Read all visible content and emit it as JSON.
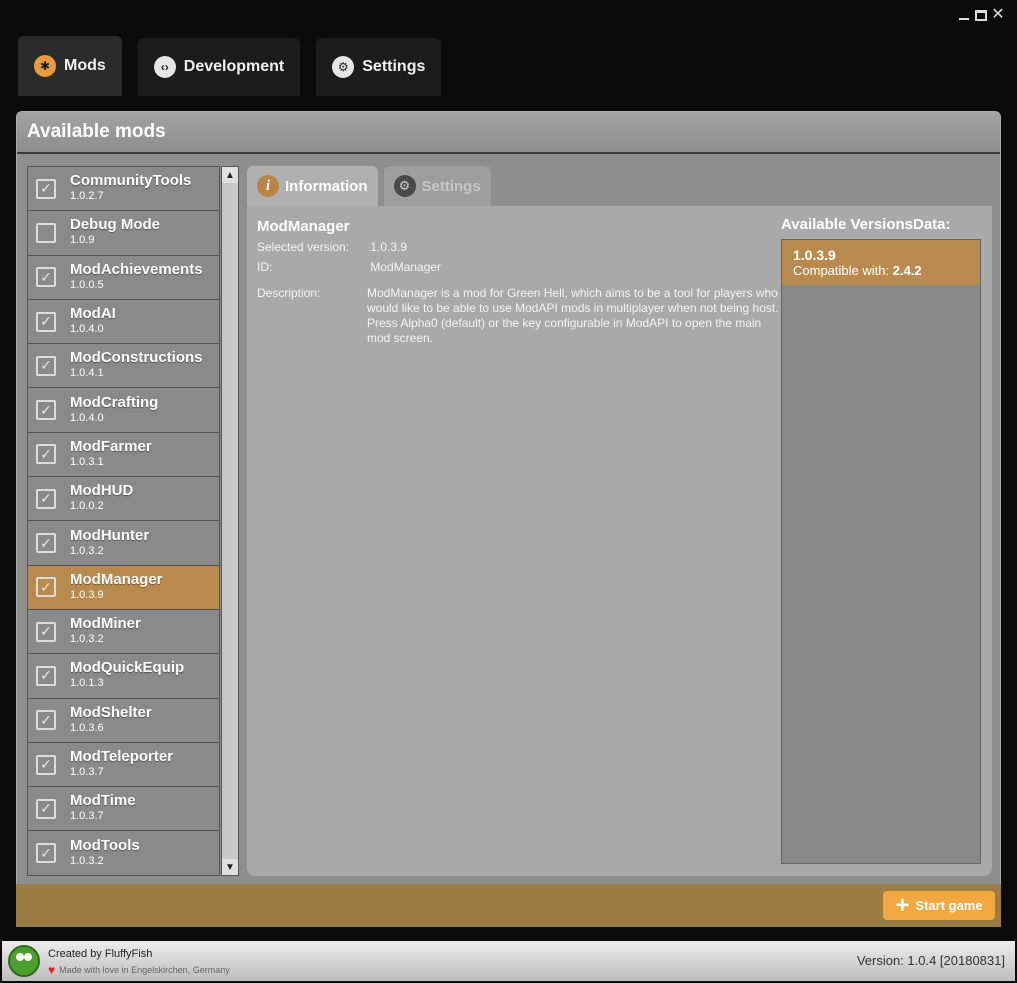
{
  "main_tabs": [
    {
      "label": "Mods"
    },
    {
      "label": "Development"
    },
    {
      "label": "Settings"
    }
  ],
  "panel": {
    "title": "Available mods"
  },
  "mods": [
    {
      "name": "CommunityTools",
      "version": "1.0.2.7",
      "checked": true
    },
    {
      "name": "Debug Mode",
      "version": "1.0.9",
      "checked": false
    },
    {
      "name": "ModAchievements",
      "version": "1.0.0.5",
      "checked": true
    },
    {
      "name": "ModAI",
      "version": "1.0.4.0",
      "checked": true
    },
    {
      "name": "ModConstructions",
      "version": "1.0.4.1",
      "checked": true
    },
    {
      "name": "ModCrafting",
      "version": "1.0.4.0",
      "checked": true
    },
    {
      "name": "ModFarmer",
      "version": "1.0.3.1",
      "checked": true
    },
    {
      "name": "ModHUD",
      "version": "1.0.0.2",
      "checked": true
    },
    {
      "name": "ModHunter",
      "version": "1.0.3.2",
      "checked": true
    },
    {
      "name": "ModManager",
      "version": "1.0.3.9",
      "checked": true
    },
    {
      "name": "ModMiner",
      "version": "1.0.3.2",
      "checked": true
    },
    {
      "name": "ModQuickEquip",
      "version": "1.0.1.3",
      "checked": true
    },
    {
      "name": "ModShelter",
      "version": "1.0.3.6",
      "checked": true
    },
    {
      "name": "ModTeleporter",
      "version": "1.0.3.7",
      "checked": true
    },
    {
      "name": "ModTime",
      "version": "1.0.3.7",
      "checked": true
    },
    {
      "name": "ModTools",
      "version": "1.0.3.2",
      "checked": true
    }
  ],
  "sub_tabs": {
    "information": "Information",
    "settings": "Settings"
  },
  "detail": {
    "title": "ModManager",
    "selected_version_label": "Selected version:",
    "selected_version": "1.0.3.9",
    "id_label": "ID:",
    "id": "ModManager",
    "description_label": "Description:",
    "description": "ModManager is a mod for Green Hell, which aims to be a tool for players who would like to be able to use ModAPI mods in multiplayer when not being host. Press Alpha0 (default) or the key configurable in ModAPI to open the main mod screen."
  },
  "versions": {
    "title": "Available VersionsData:",
    "items": [
      {
        "version": "1.0.3.9",
        "compat_label": "Compatible with:",
        "compat": "2.4.2"
      }
    ]
  },
  "start_button": "Start game",
  "status": {
    "creator": "Created by FluffyFish",
    "love": "Made with love in Engelskirchen, Germany",
    "version": "Version:  1.0.4 [20180831]"
  },
  "icons": {
    "mods_tab": "puzzle-icon",
    "development_tab": "code-icon",
    "settings_tab": "gear-icon",
    "info": "info-icon",
    "check": "check-icon"
  },
  "colors": {
    "accent": "#b98a4e",
    "footer": "#9b7d44",
    "start_button": "#f0a83f"
  }
}
